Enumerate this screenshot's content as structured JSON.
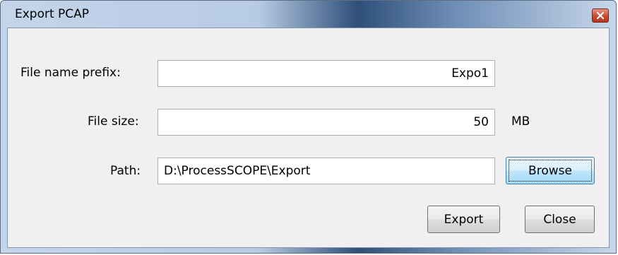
{
  "window": {
    "title": "Export PCAP",
    "close_icon": "close-x-icon"
  },
  "form": {
    "prefix_label": "File name prefix:",
    "prefix_value": "Expo1",
    "size_label": "File size:",
    "size_value": "50",
    "size_unit": "MB",
    "path_label": "Path:",
    "path_value": "D:\\ProcessSCOPE\\Export"
  },
  "buttons": {
    "browse_label": "Browse",
    "export_label": "Export",
    "close_label": "Close"
  },
  "colors": {
    "close_button": "#c94a32",
    "focus_button": "#bee6fd",
    "dialog_background": "#f0f0f0"
  }
}
